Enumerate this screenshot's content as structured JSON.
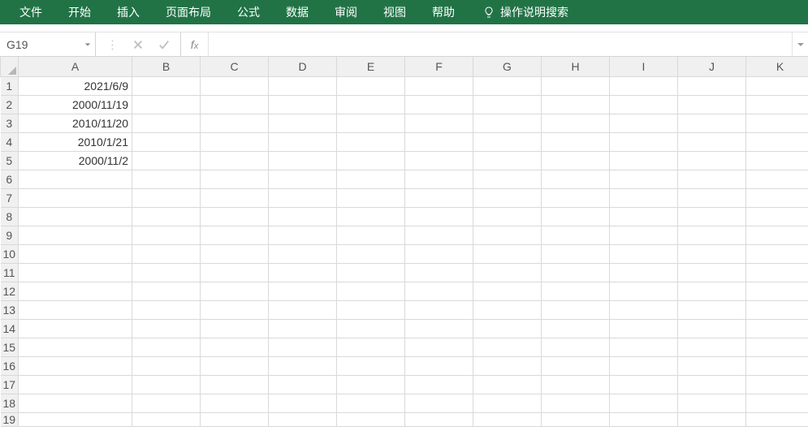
{
  "menu": {
    "tabs": [
      "文件",
      "开始",
      "插入",
      "页面布局",
      "公式",
      "数据",
      "审阅",
      "视图",
      "帮助"
    ],
    "tell_me": "操作说明搜索"
  },
  "formula_bar": {
    "name_box": "G19",
    "formula": ""
  },
  "grid": {
    "columns": [
      "A",
      "B",
      "C",
      "D",
      "E",
      "F",
      "G",
      "H",
      "I",
      "J",
      "K"
    ],
    "row_count": 19,
    "cells": {
      "A1": "2021/6/9",
      "A2": "2000/11/19",
      "A3": "2010/11/20",
      "A4": "2010/1/21",
      "A5": "2000/11/2"
    }
  }
}
